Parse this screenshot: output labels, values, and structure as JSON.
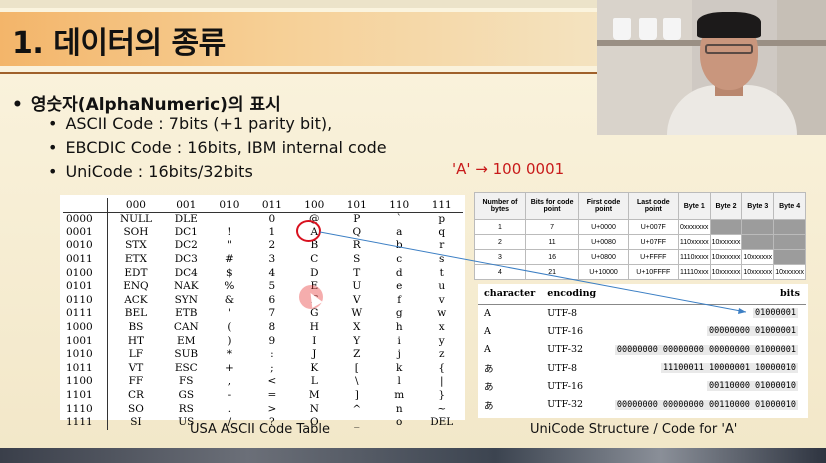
{
  "slide": {
    "title": "1. 데이터의 종류",
    "main_bullet": "영숫자(AlphaNumeric)의 표시",
    "sub_bullets": [
      "ASCII Code : 7bits (+1 parity bit),",
      "EBCDIC Code : 16bits, IBM internal code",
      "UniCode : 16bits/32bits"
    ],
    "conversion_label": "'A' → 100 0001"
  },
  "ascii": {
    "caption": "USA ASCII Code Table",
    "col_headers": [
      "",
      "000",
      "001",
      "010",
      "011",
      "100",
      "101",
      "110",
      "111"
    ],
    "rows": [
      [
        "0000",
        "NULL",
        "DLE",
        "",
        "0",
        "@",
        "P",
        "`",
        "p"
      ],
      [
        "0001",
        "SOH",
        "DC1",
        "!",
        "1",
        "A",
        "Q",
        "a",
        "q"
      ],
      [
        "0010",
        "STX",
        "DC2",
        "\"",
        "2",
        "B",
        "R",
        "b",
        "r"
      ],
      [
        "0011",
        "ETX",
        "DC3",
        "#",
        "3",
        "C",
        "S",
        "c",
        "s"
      ],
      [
        "0100",
        "EDT",
        "DC4",
        "$",
        "4",
        "D",
        "T",
        "d",
        "t"
      ],
      [
        "0101",
        "ENQ",
        "NAK",
        "%",
        "5",
        "E",
        "U",
        "e",
        "u"
      ],
      [
        "0110",
        "ACK",
        "SYN",
        "&",
        "6",
        "F",
        "V",
        "f",
        "v"
      ],
      [
        "0111",
        "BEL",
        "ETB",
        "'",
        "7",
        "G",
        "W",
        "g",
        "w"
      ],
      [
        "1000",
        "BS",
        "CAN",
        "(",
        "8",
        "H",
        "X",
        "h",
        "x"
      ],
      [
        "1001",
        "HT",
        "EM",
        ")",
        "9",
        "I",
        "Y",
        "i",
        "y"
      ],
      [
        "1010",
        "LF",
        "SUB",
        "*",
        ":",
        "J",
        "Z",
        "j",
        "z"
      ],
      [
        "1011",
        "VT",
        "ESC",
        "+",
        ";",
        "K",
        "[",
        "k",
        "{"
      ],
      [
        "1100",
        "FF",
        "FS",
        ",",
        "<",
        "L",
        "\\",
        "l",
        "|"
      ],
      [
        "1101",
        "CR",
        "GS",
        "-",
        "=",
        "M",
        "]",
        "m",
        "}"
      ],
      [
        "1110",
        "SO",
        "RS",
        ".",
        ">",
        "N",
        "^",
        "n",
        "~"
      ],
      [
        "1111",
        "SI",
        "US",
        "/",
        "?",
        "O",
        "_",
        "o",
        "DEL"
      ]
    ]
  },
  "utf_structure": {
    "headers": [
      "Number of bytes",
      "Bits for code point",
      "First code point",
      "Last code point",
      "Byte 1",
      "Byte 2",
      "Byte 3",
      "Byte 4"
    ],
    "rows": [
      [
        "1",
        "7",
        "U+0000",
        "U+007F",
        "0xxxxxxx",
        "",
        "",
        ""
      ],
      [
        "2",
        "11",
        "U+0080",
        "U+07FF",
        "110xxxxx",
        "10xxxxxx",
        "",
        ""
      ],
      [
        "3",
        "16",
        "U+0800",
        "U+FFFF",
        "1110xxxx",
        "10xxxxxx",
        "10xxxxxx",
        ""
      ],
      [
        "4",
        "21",
        "U+10000",
        "U+10FFFF",
        "11110xxx",
        "10xxxxxx",
        "10xxxxxx",
        "10xxxxxx"
      ]
    ]
  },
  "encodings": {
    "caption": "UniCode Structure / Code for 'A'",
    "headers": [
      "character",
      "encoding",
      "bits"
    ],
    "rows": [
      [
        "A",
        "UTF-8",
        "01000001"
      ],
      [
        "A",
        "UTF-16",
        "00000000 01000001"
      ],
      [
        "A",
        "UTF-32",
        "00000000 00000000 00000000 01000001"
      ],
      [
        "あ",
        "UTF-8",
        "11100011 10000001 10000010"
      ],
      [
        "あ",
        "UTF-16",
        "00110000 01000010"
      ],
      [
        "あ",
        "UTF-32",
        "00000000 00000000 00110000 01000010"
      ]
    ]
  },
  "colors": {
    "header_orange": "#f3b56a",
    "circle_red": "#d8111f",
    "label_red": "#c81a1a",
    "link_blue": "#3c7fc4"
  }
}
